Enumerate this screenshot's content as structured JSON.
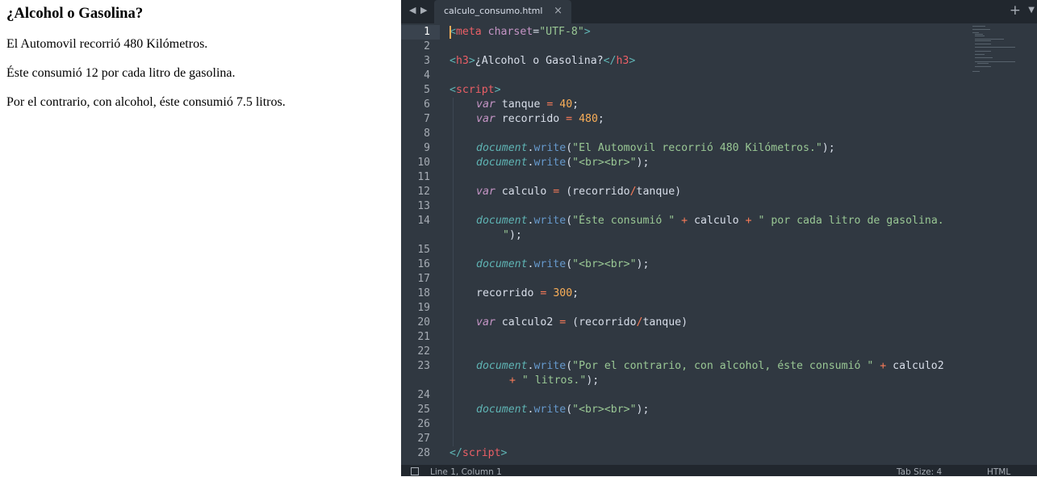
{
  "browser": {
    "heading": "¿Alcohol o Gasolina?",
    "output_lines": [
      "El Automovil recorrió 480 Kilómetros.",
      "Éste consumió 12 por cada litro de gasolina.",
      "Por el contrario, con alcohol, éste consumió 7.5 litros."
    ]
  },
  "editor": {
    "tab": {
      "title": "calculo_consumo.html",
      "close_glyph": "×"
    },
    "new_tab_glyph": "+",
    "current_line": 1,
    "line_numbers": [
      "1",
      "2",
      "3",
      "4",
      "5",
      "6",
      "7",
      "8",
      "9",
      "10",
      "11",
      "12",
      "13",
      "14",
      "15",
      "16",
      "17",
      "18",
      "19",
      "20",
      "21",
      "22",
      "23",
      "24",
      "25",
      "26",
      "27",
      "28"
    ],
    "code": {
      "l1": [
        "<",
        "meta",
        " charset",
        "=",
        "\"UTF-8\"",
        ">"
      ],
      "l3": [
        "<",
        "h3",
        ">",
        "¿Alcohol o Gasolina?",
        "</",
        "h3",
        ">"
      ],
      "l5": [
        "<",
        "script",
        ">"
      ],
      "l6": [
        "var",
        " tanque ",
        "=",
        " ",
        "40",
        ";"
      ],
      "l7": [
        "var",
        " recorrido ",
        "=",
        " ",
        "480",
        ";"
      ],
      "l9": [
        "document",
        ".",
        "write",
        "(",
        "\"El Automovil recorrió 480 Kilómetros.\"",
        ");"
      ],
      "l10": [
        "document",
        ".",
        "write",
        "(",
        "\"<br><br>\"",
        ");"
      ],
      "l12": [
        "var",
        " calculo ",
        "=",
        " (recorrido",
        "/",
        "tanque)"
      ],
      "l14": [
        "document",
        ".",
        "write",
        "(",
        "\"Éste consumió \"",
        " ",
        "+",
        " calculo ",
        "+",
        " ",
        "\" por cada litro de gasolina."
      ],
      "l14b": [
        "\"",
        ");"
      ],
      "l16": [
        "document",
        ".",
        "write",
        "(",
        "\"<br><br>\"",
        ");"
      ],
      "l18": [
        "recorrido ",
        "=",
        " ",
        "300",
        ";"
      ],
      "l20": [
        "var",
        " calculo2 ",
        "=",
        " (recorrido",
        "/",
        "tanque)"
      ],
      "l23": [
        "document",
        ".",
        "write",
        "(",
        "\"Por el contrario, con alcohol, éste consumió \"",
        " ",
        "+",
        " calculo2"
      ],
      "l23b": [
        "+",
        " ",
        "\" litros.\"",
        ");"
      ],
      "l25": [
        "document",
        ".",
        "write",
        "(",
        "\"<br><br>\"",
        ");"
      ],
      "l28": [
        "</",
        "script",
        ">"
      ]
    }
  },
  "statusbar": {
    "position": "Line 1, Column 1",
    "tab_size": "Tab Size: 4",
    "syntax": "HTML"
  },
  "colors": {
    "editor_bg": "#303841",
    "tabbar_bg": "#21272e",
    "tag": "#ec5f66",
    "string": "#99c794",
    "keyword": "#c695c6",
    "number": "#f9ae58",
    "function": "#6699cc",
    "object": "#5fb4b4"
  },
  "icons": [
    "arrow-left-icon",
    "arrow-right-icon",
    "close-icon",
    "plus-icon",
    "dropdown-icon",
    "panel-toggle-icon"
  ]
}
